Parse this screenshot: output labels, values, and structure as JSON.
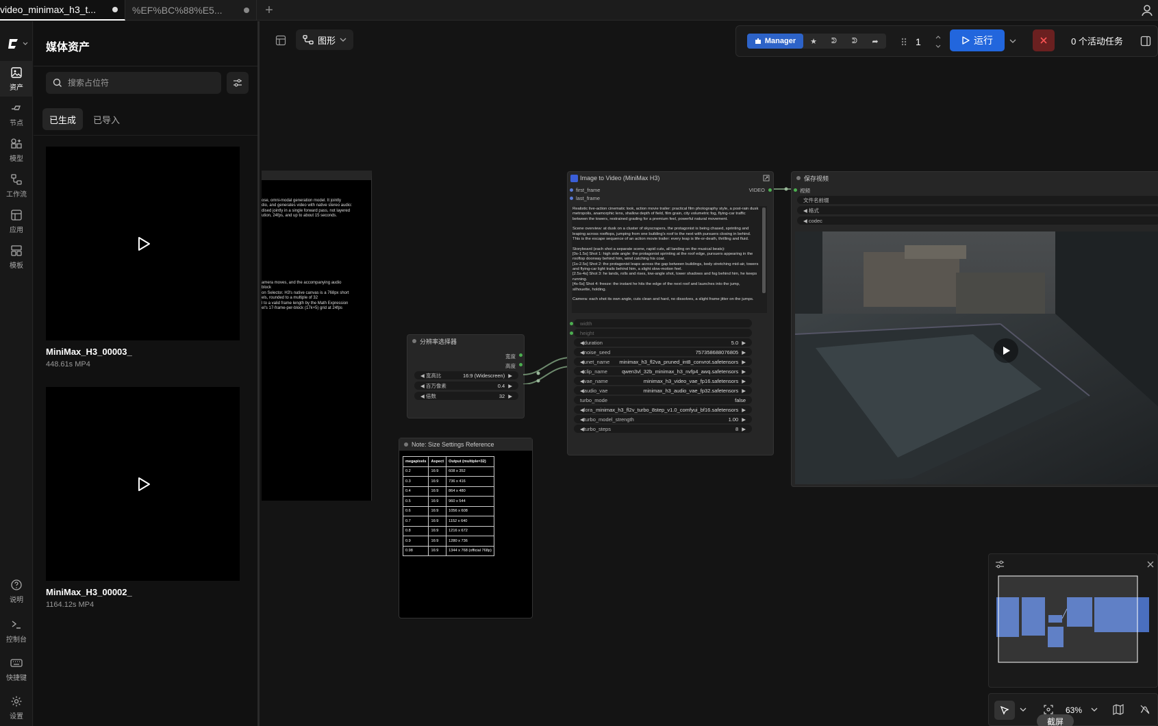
{
  "tabs": [
    {
      "title": "video_minimax_h3_t...",
      "modified": true
    },
    {
      "title": "%EF%BC%88%E5...",
      "modified": true
    }
  ],
  "rail": {
    "items": [
      {
        "label": "资产",
        "icon": "image-icon",
        "active": true
      },
      {
        "label": "节点",
        "icon": "node-icon"
      },
      {
        "label": "模型",
        "icon": "model-icon"
      },
      {
        "label": "工作流",
        "icon": "workflow-icon"
      },
      {
        "label": "应用",
        "icon": "app-icon"
      },
      {
        "label": "模板",
        "icon": "template-icon"
      }
    ],
    "bottom": [
      {
        "label": "说明",
        "icon": "help-icon"
      },
      {
        "label": "控制台",
        "icon": "terminal-icon"
      },
      {
        "label": "快捷键",
        "icon": "keyboard-icon"
      },
      {
        "label": "设置",
        "icon": "gear-icon"
      }
    ]
  },
  "panel": {
    "title": "媒体资产",
    "search_placeholder": "搜索占位符",
    "tabs": [
      "已生成",
      "已导入"
    ],
    "assets": [
      {
        "name": "MiniMax_H3_00003_",
        "meta": "448.61s  MP4"
      },
      {
        "name": "MiniMax_H3_00002_",
        "meta": "1164.12s  MP4"
      }
    ]
  },
  "canvas": {
    "graph_label": "图形"
  },
  "toolbar": {
    "manager_label": "Manager",
    "queue_count": "1",
    "run_label": "运行",
    "active_tasks": "0 个活动任务"
  },
  "left_note": {
    "lines_top": "ose, omni-modal generation model. It jointly\ndio, and generates video with native stereo audio:\ndised jointly in a single forward pass, not layered\nution, 24fps, and up to about 15 seconds.",
    "lines_bottom": "amera moves, and the accompanying audio\nblock\non Selector. H3's native canvas is a 768px short\nels, rounded to a multiple of 32\nl to a valid frame length by the Math Expression\nel's 17-frame-per-block (17k+5) grid at 24fps"
  },
  "resolution_node": {
    "title": "分辨率选择器",
    "outputs": [
      "宽度",
      "高度"
    ],
    "widgets": [
      {
        "label": "宽高比",
        "value": "16:9 (Widescreen)"
      },
      {
        "label": "百万像素",
        "value": "0.4"
      },
      {
        "label": "倍数",
        "value": "32"
      }
    ]
  },
  "note_node": {
    "title": "Note: Size Settings Reference",
    "headers": [
      "megapixels",
      "Aspect",
      "Output (multiple=32)"
    ],
    "rows": [
      [
        "0.2",
        "16:9",
        "608 x 352"
      ],
      [
        "0.3",
        "16:9",
        "736 x 416"
      ],
      [
        "0.4",
        "16:9",
        "864 x 480"
      ],
      [
        "0.5",
        "16:9",
        "960 x 544"
      ],
      [
        "0.6",
        "16:9",
        "1056 x 608"
      ],
      [
        "0.7",
        "16:9",
        "1152 x 640"
      ],
      [
        "0.8",
        "16:9",
        "1216 x 672"
      ],
      [
        "0.9",
        "16:9",
        "1280 x 736"
      ],
      [
        "0.98",
        "16:9",
        "1344 x 768 (official 768p)"
      ]
    ]
  },
  "i2v_node": {
    "title": "Image to Video (MiniMax H3)",
    "inputs": [
      "first_frame",
      "last_frame"
    ],
    "output": "VIDEO",
    "prompt": "Realistic live-action cinematic look, action movie trailer: practical film photography style, a post-rain dusk metropolis, anamorphic lens, shallow depth of field, film grain, city volumetric fog, flying-car traffic between the towers, restrained grading for a premium feel, powerful natural movement.\n\nScene overview: at dusk on a cluster of skyscrapers, the protagonist is being chased, sprinting and leaping across rooftops, jumping from one building's roof to the next with pursuers closing in behind. This is the escape sequence of an action movie trailer: every leap is life-or-death, thrilling and fluid.\n\nStoryboard (each shot a separate scene, rapid cuts, all landing on the musical beats):\n[0s-1.5s] Shot 1: high side angle: the protagonist sprinting at the roof edge, pursuers appearing in the rooftop doorway behind him, wind catching his coat.\n[1s-2.5s] Shot 2: the protagonist leaps across the gap between buildings, body stretching mid-air, towers and flying-car light trails behind him, a slight slow-motion feel.\n[2.5s-4s] Shot 3: he lands, rolls and rises, low-angle shot, tower shadows and fog behind him, he keeps running.\n[4s-5s] Shot 4: freeze: the instant he hits the edge of the next roof and launches into the jump, silhouette, holding.\n\nCamera: each shot its own angle, cuts clean and hard, no dissolves, a slight frame jitter on the jumps.",
    "widgets": [
      {
        "label": "width",
        "value": "",
        "dim": true
      },
      {
        "label": "height",
        "value": "",
        "dim": true
      },
      {
        "label": "duration",
        "value": "5.0"
      },
      {
        "label": "noise_seed",
        "value": "757358688076805"
      },
      {
        "label": "unet_name",
        "value": "minimax_h3_fl2va_pruned_int8_convrot.safetensors"
      },
      {
        "label": "clip_name",
        "value": "qwen3vl_32b_minimax_h3_nvfp4_awq.safetensors"
      },
      {
        "label": "vae_name",
        "value": "minimax_h3_video_vae_fp16.safetensors"
      },
      {
        "label": "audio_vae",
        "value": "minimax_h3_audio_vae_fp32.safetensors"
      },
      {
        "label": "turbo_mode",
        "value": "false"
      },
      {
        "label": "lora_n ...",
        "value": "minimax_h3_fl2v_turbo_8step_v1.0_comfyui_bf16.safetensors"
      },
      {
        "label": "turbo_model_strength",
        "value": "1.00"
      },
      {
        "label": "turbo_steps",
        "value": "8"
      }
    ]
  },
  "save_node": {
    "title": "保存视频",
    "input": "视频",
    "widgets": [
      "文件名前缀",
      "格式",
      "codec"
    ]
  },
  "zoom": {
    "level": "63%",
    "screenshot_label": "截屏"
  },
  "colors": {
    "accent": "#2266dd",
    "socket_green": "#4caf50",
    "minimap_node": "#4a6fbf"
  }
}
